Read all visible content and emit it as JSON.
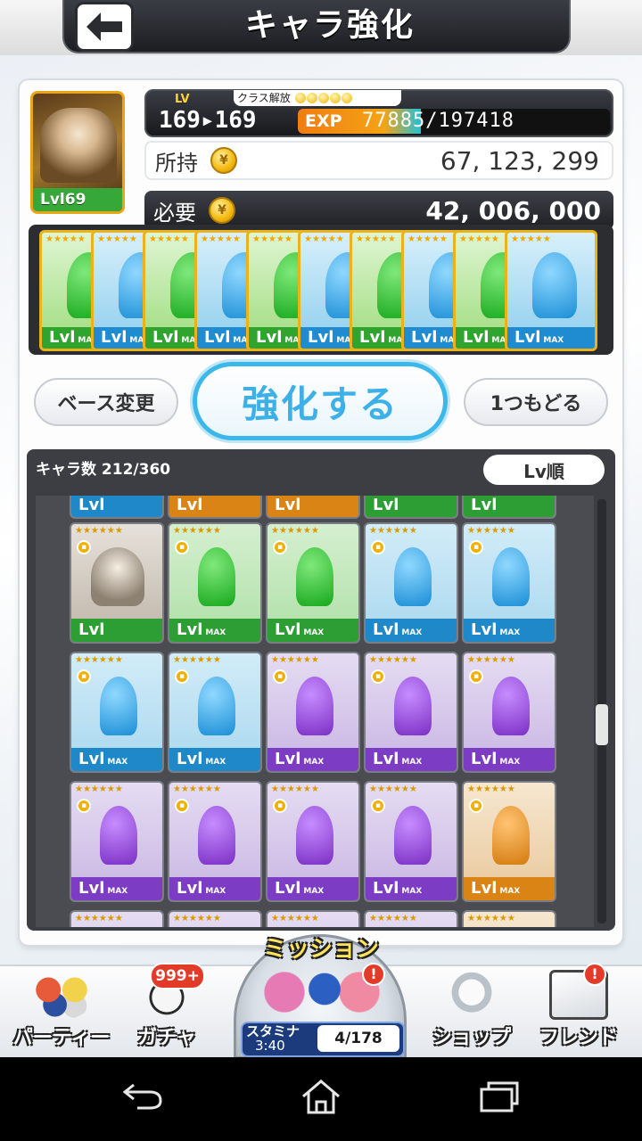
{
  "header": {
    "title": "キャラ強化"
  },
  "base_character": {
    "level_badge": "Lvl69"
  },
  "level": {
    "lv_tag": "LV",
    "class_release_label": "クラス解放",
    "class_release_orbs": 5,
    "current_to_next": "169▸169",
    "exp_label": "EXP",
    "exp_value": "77885/197418",
    "exp_current": 77885,
    "exp_max": 197418
  },
  "owned": {
    "label": "所持",
    "value": "67, 123, 299"
  },
  "required": {
    "label": "必要",
    "value": "42, 006, 000"
  },
  "materials": [
    {
      "type": "green",
      "lvl": "Lvl",
      "max": "MAX"
    },
    {
      "type": "blue",
      "lvl": "Lvl",
      "max": "MAX"
    },
    {
      "type": "green",
      "lvl": "Lvl",
      "max": "MAX"
    },
    {
      "type": "blue",
      "lvl": "Lvl",
      "max": "MAX"
    },
    {
      "type": "green",
      "lvl": "Lvl",
      "max": "MAX"
    },
    {
      "type": "blue",
      "lvl": "Lvl",
      "max": "MAX"
    },
    {
      "type": "green",
      "lvl": "Lvl",
      "max": "MAX"
    },
    {
      "type": "blue",
      "lvl": "Lvl",
      "max": "MAX"
    },
    {
      "type": "green",
      "lvl": "Lvl",
      "max": "MAX"
    },
    {
      "type": "blue",
      "lvl": "Lvl",
      "max": "MAX"
    }
  ],
  "actions": {
    "base_change": "ベース変更",
    "enhance": "強化する",
    "undo": "1つもどる"
  },
  "char_list": {
    "count_label": "キャラ数 212/360",
    "sort_label": "Lv順",
    "rows": [
      [
        "hero",
        "green",
        "green",
        "blue",
        "blue"
      ],
      [
        "blue",
        "blue",
        "purple",
        "purple",
        "purple"
      ],
      [
        "purple",
        "purple",
        "purple",
        "purple",
        "orange"
      ]
    ],
    "top_partial_row": [
      "blue",
      "orange",
      "orange",
      "green",
      "green"
    ],
    "lvl_label": "Lvl",
    "max_label": "MAX"
  },
  "bottom_nav": {
    "party": "パーティー",
    "gacha": "ガチャ",
    "gacha_badge": "999+",
    "mission": "ミッション",
    "mission_badge": "!",
    "stamina_label": "スタミナ",
    "stamina_time": "3:40",
    "stamina_value": "4/178",
    "shop": "ショップ",
    "friend": "フレンド",
    "friend_badge": "!"
  },
  "icons": {
    "back": "back-arrow-icon",
    "coin": "gold-coin-icon",
    "sys_back": "android-back-icon",
    "sys_home": "android-home-icon",
    "sys_recent": "android-recent-apps-icon"
  }
}
